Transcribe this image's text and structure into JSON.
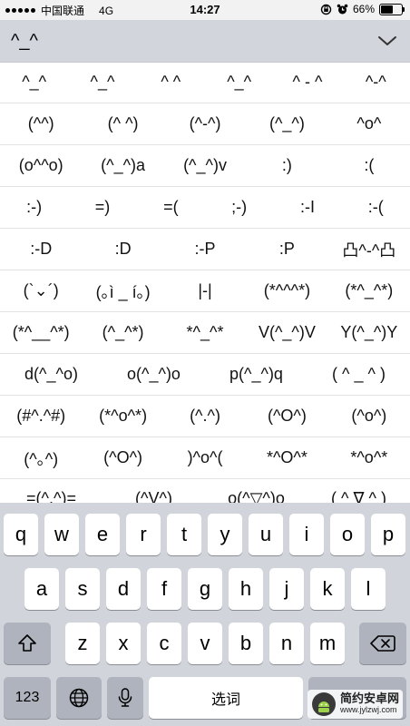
{
  "status_bar": {
    "carrier": "中国联通",
    "network": "4G",
    "time": "14:27",
    "battery_percent": "66%",
    "battery_level": 0.66
  },
  "emoticon_panel": {
    "title": "^_^",
    "rows": [
      [
        "^_^",
        "^_^",
        "^ ^",
        "^_^",
        "^ - ^",
        "^-^"
      ],
      [
        "(^^)",
        "(^ ^)",
        "(^-^)",
        "(^_^)",
        "^o^"
      ],
      [
        "(o^^o)",
        "(^_^)a",
        "(^_^)v",
        ":)",
        ":("
      ],
      [
        ":-)",
        "=)",
        "=(",
        ";-)",
        ":-I",
        ":-("
      ],
      [
        ":-D",
        ":D",
        ":-P",
        ":P",
        "凸^-^凸"
      ],
      [
        "(`⌄´)",
        "(｡ì _ í｡)",
        "|-|",
        "(*^^^*)",
        "(*^_^*)"
      ],
      [
        "(*^__^*)",
        "(^_^*)",
        "*^_^*",
        "V(^_^)V",
        "Y(^_^)Y"
      ],
      [
        "d(^_^o)",
        "o(^_^)o",
        "p(^_^)q",
        "( ^ _ ^ )"
      ],
      [
        "(#^.^#)",
        "(*^o^*)",
        "(^.^)",
        "(^O^)",
        "(^o^)"
      ],
      [
        "(^｡^)",
        "(^O^)",
        ")^o^(",
        "*^O^*",
        "*^o^*"
      ],
      [
        "=(^.^)=",
        "(^V^)",
        "o(^▽^)o",
        "( ^ ∇ ^ )"
      ]
    ]
  },
  "keyboard": {
    "row1": [
      "q",
      "w",
      "e",
      "r",
      "t",
      "y",
      "u",
      "i",
      "o",
      "p"
    ],
    "row2": [
      "a",
      "s",
      "d",
      "f",
      "g",
      "h",
      "j",
      "k",
      "l"
    ],
    "row3": [
      "z",
      "x",
      "c",
      "v",
      "b",
      "n",
      "m"
    ],
    "numbers_label": "123",
    "space_label": "选词"
  },
  "watermark": {
    "name": "简约安卓网",
    "url": "www.jylzwj.com"
  },
  "icons": {
    "shift": "shift-icon",
    "backspace": "backspace-icon",
    "globe": "globe-icon",
    "mic": "microphone-icon",
    "collapse": "chevron-down-icon"
  }
}
